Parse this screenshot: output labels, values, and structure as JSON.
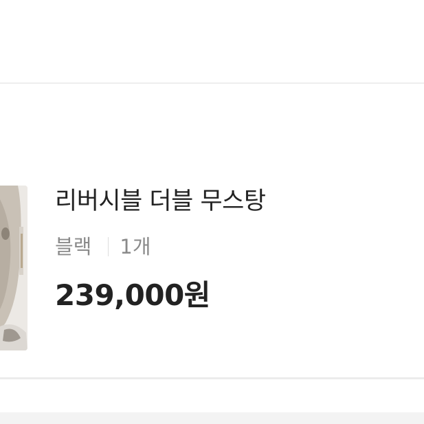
{
  "product": {
    "name": "리버시블 더블 무스탕",
    "option_color": "블랙",
    "option_quantity": "1개",
    "price": "239,000원",
    "thumbnail_icon": "product-photo"
  },
  "colors": {
    "title": "#222222",
    "option_text": "#8a8a8a",
    "divider": "#eeeeee",
    "bottom_strip": "#f3f3f3"
  }
}
